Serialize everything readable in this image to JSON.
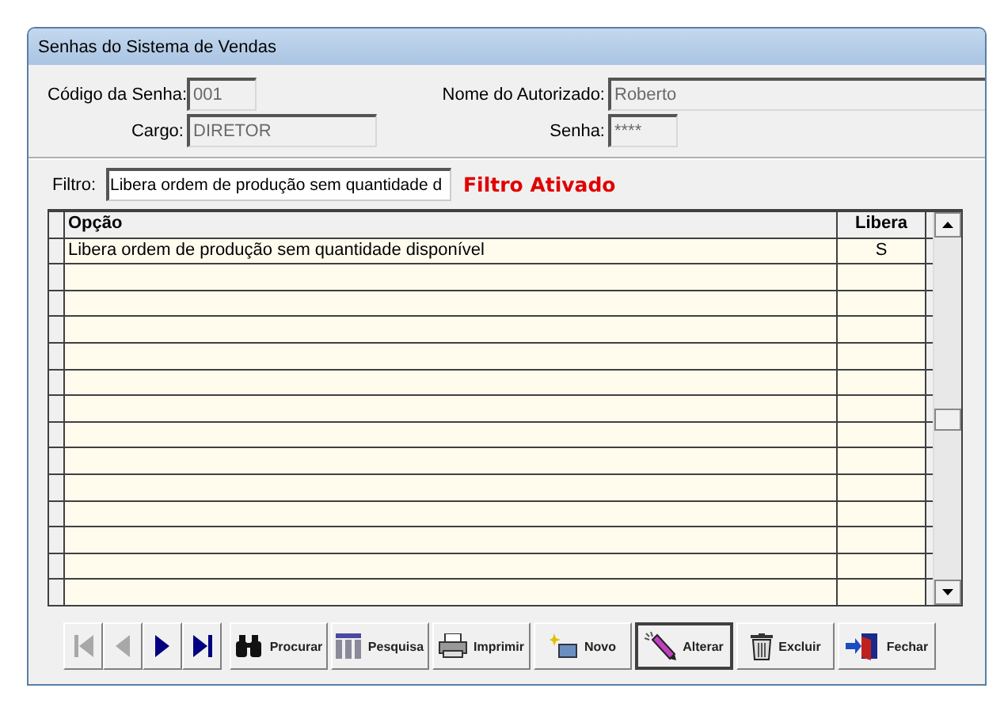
{
  "window": {
    "title": "Senhas do Sistema de Vendas"
  },
  "fields": [
    {
      "label": "Código da Senha:",
      "value": "001",
      "kind": "short"
    },
    {
      "label": "Nome do Autorizado:",
      "value": "Roberto",
      "kind": "long"
    },
    {
      "label": "Cargo:",
      "value": "DIRETOR",
      "kind": "medium"
    },
    {
      "label": "Senha:",
      "value": "****",
      "kind": "short"
    }
  ],
  "filter": {
    "label": "Filtro:",
    "value": "Libera ordem de produção sem quantidade d",
    "status": "Filtro Ativado"
  },
  "table": {
    "columns": [
      "Opção",
      "Libera"
    ],
    "rows": [
      {
        "cells": [
          "Libera ordem de produção sem quantidade disponível",
          "S"
        ]
      }
    ]
  },
  "nav_buttons": [
    {
      "kind": "first",
      "disabled": true
    },
    {
      "kind": "prev",
      "disabled": true
    },
    {
      "kind": "next",
      "disabled": false
    },
    {
      "kind": "last",
      "disabled": false
    }
  ],
  "buttons": [
    {
      "label": "Procurar",
      "kind": "binoculars",
      "focused": false
    },
    {
      "label": "Pesquisa",
      "kind": "grid",
      "focused": false
    },
    {
      "label": "Imprimir",
      "kind": "printer",
      "focused": false
    },
    {
      "label": "Novo",
      "kind": "new",
      "focused": false
    },
    {
      "label": "Alterar",
      "kind": "pencil",
      "focused": true
    },
    {
      "label": "Excluir",
      "kind": "trash",
      "focused": false
    },
    {
      "label": "Fechar",
      "kind": "door",
      "focused": false
    }
  ]
}
